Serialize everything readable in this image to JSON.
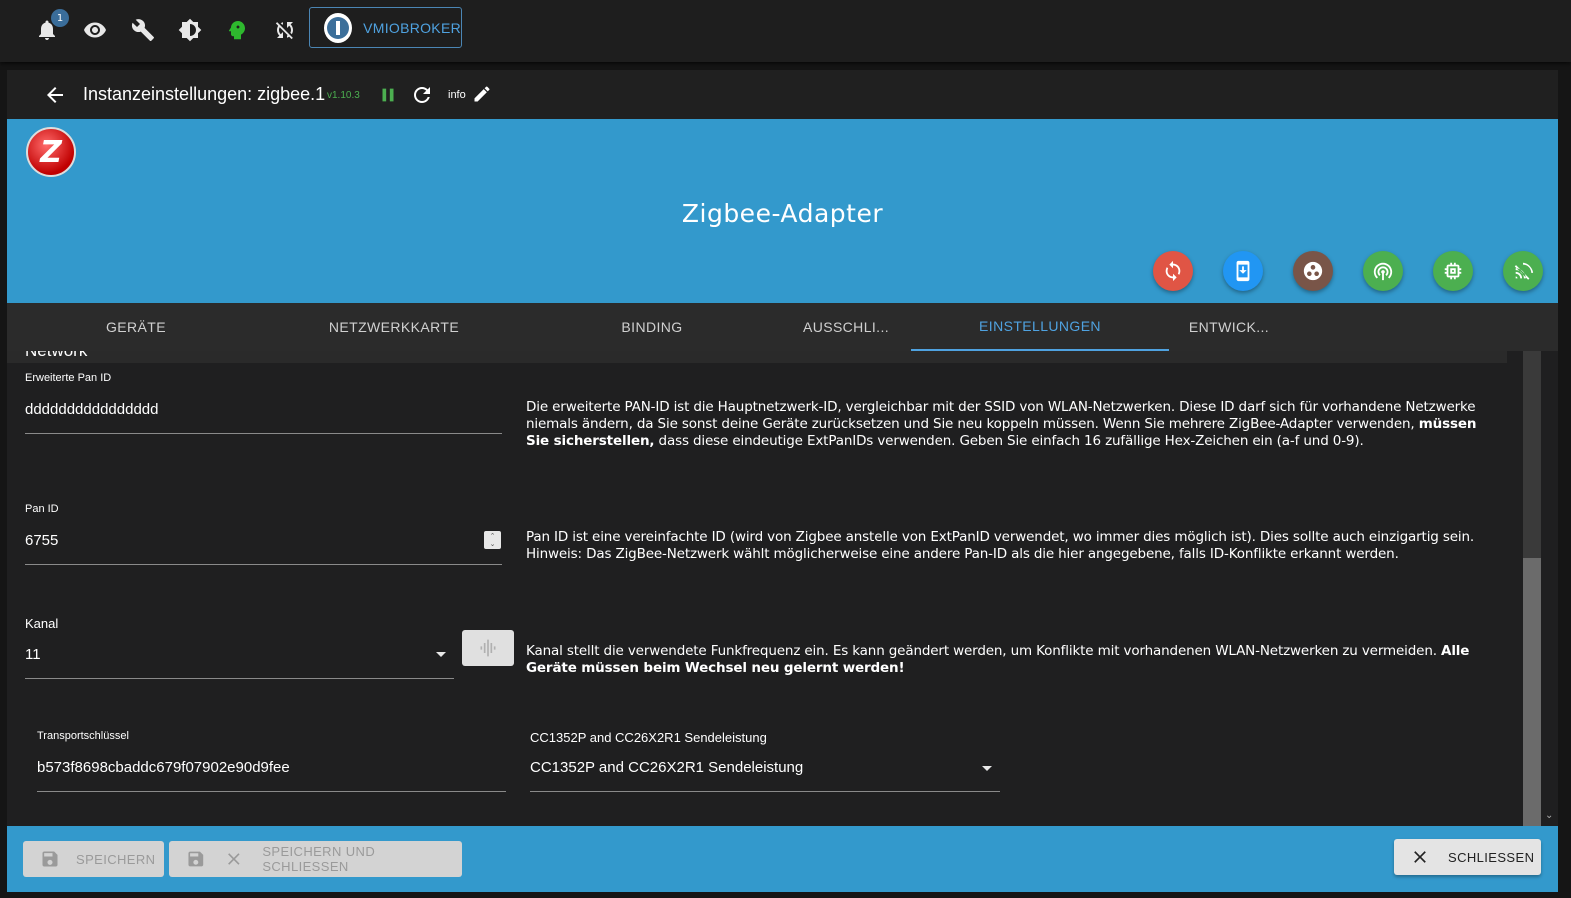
{
  "topbar": {
    "notification_count": "1",
    "brand_label": "VMIOBROKER"
  },
  "dialog": {
    "title": "Instanzeinstellungen: zigbee.1",
    "version": "v1.10.3",
    "info_label": "info"
  },
  "header": {
    "app_title": "Zigbee-Adapter",
    "logo_letter": "Z",
    "action_colors": [
      "#e05545",
      "#2196f3",
      "#795548",
      "#4caf50",
      "#4caf50",
      "#4caf50"
    ]
  },
  "tabs": [
    {
      "label": "GERÄTE"
    },
    {
      "label": "NETZWERKKARTE"
    },
    {
      "label": "BINDING"
    },
    {
      "label": "AUSSCHLI..."
    },
    {
      "label": "EINSTELLUNGEN",
      "active": true
    },
    {
      "label": "ENTWICK..."
    }
  ],
  "section": {
    "title": "Network"
  },
  "fields": {
    "ext_pan_id": {
      "label": "Erweiterte Pan ID",
      "value": "dddddddddddddddd",
      "desc_1": "Die erweiterte PAN-ID ist die Hauptnetzwerk-ID, vergleichbar mit der SSID von WLAN-Netzwerken. Diese ID darf sich für vorhandene Netzwerke niemals ändern, da Sie sonst deine Geräte zurücksetzen und Sie neu koppeln müssen. Wenn Sie mehrere ZigBee-Adapter verwenden, ",
      "desc_bold": "müssen Sie sicherstellen,",
      "desc_2": " dass diese eindeutige ExtPanIDs verwenden. Geben Sie einfach 16 zufällige Hex-Zeichen ein (a-f und 0-9)."
    },
    "pan_id": {
      "label": "Pan ID",
      "value": "6755",
      "desc": "Pan ID ist eine vereinfachte ID (wird von Zigbee anstelle von ExtPanID verwendet, wo immer dies möglich ist). Dies sollte auch einzigartig sein. Hinweis: Das ZigBee-Netzwerk wählt möglicherweise eine andere Pan-ID als die hier angegebene, falls ID-Konflikte erkannt werden."
    },
    "channel": {
      "label": "Kanal",
      "value": "11",
      "desc_1": "Kanal stellt die verwendete Funkfrequenz ein. Es kann geändert werden, um Konflikte mit vorhandenen WLAN-Netzwerken zu vermeiden. ",
      "desc_bold": "Alle Geräte müssen beim Wechsel neu gelernt werden!"
    },
    "transport_key": {
      "label": "Transportschlüssel",
      "value": "b573f8698cbaddc679f07902e90d9fee"
    },
    "tx_power": {
      "label": "CC1352P and CC26X2R1 Sendeleistung",
      "value": "CC1352P and CC26X2R1 Sendeleistung"
    }
  },
  "footer": {
    "save_label": "SPEICHERN",
    "save_close_label": "SPEICHERN UND SCHLIESSEN",
    "close_label": "SCHLIESSEN"
  }
}
